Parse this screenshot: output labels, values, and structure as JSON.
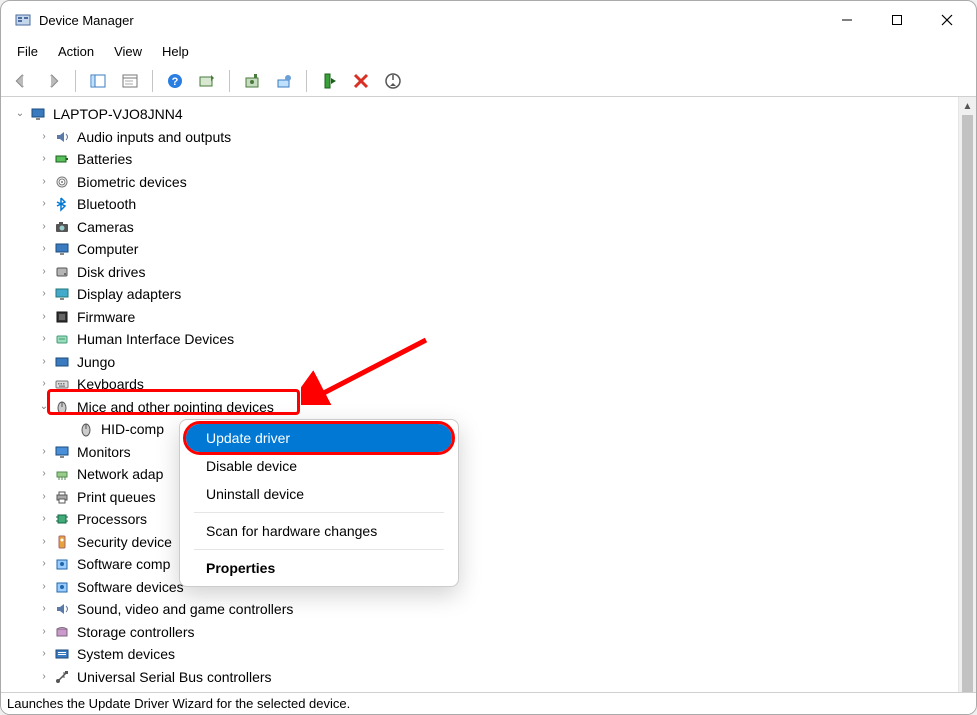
{
  "title": "Device Manager",
  "menus": {
    "file": "File",
    "action": "Action",
    "view": "View",
    "help": "Help"
  },
  "root": "LAPTOP-VJO8JNN4",
  "categories": [
    {
      "label": "Audio inputs and outputs",
      "icon": "audio"
    },
    {
      "label": "Batteries",
      "icon": "battery"
    },
    {
      "label": "Biometric devices",
      "icon": "biometric"
    },
    {
      "label": "Bluetooth",
      "icon": "bluetooth"
    },
    {
      "label": "Cameras",
      "icon": "camera"
    },
    {
      "label": "Computer",
      "icon": "computer"
    },
    {
      "label": "Disk drives",
      "icon": "disk"
    },
    {
      "label": "Display adapters",
      "icon": "display"
    },
    {
      "label": "Firmware",
      "icon": "firmware"
    },
    {
      "label": "Human Interface Devices",
      "icon": "hid"
    },
    {
      "label": "Jungo",
      "icon": "jungo"
    },
    {
      "label": "Keyboards",
      "icon": "keyboard"
    },
    {
      "label": "Mice and other pointing devices",
      "icon": "mouse",
      "expanded": true,
      "children": [
        "HID-comp"
      ]
    },
    {
      "label": "Monitors",
      "icon": "monitor"
    },
    {
      "label": "Network adap",
      "icon": "network"
    },
    {
      "label": "Print queues",
      "icon": "printer"
    },
    {
      "label": "Processors",
      "icon": "cpu"
    },
    {
      "label": "Security device",
      "icon": "security"
    },
    {
      "label": "Software comp",
      "icon": "soft"
    },
    {
      "label": "Software devices",
      "icon": "soft"
    },
    {
      "label": "Sound, video and game controllers",
      "icon": "audio"
    },
    {
      "label": "Storage controllers",
      "icon": "storage"
    },
    {
      "label": "System devices",
      "icon": "system"
    },
    {
      "label": "Universal Serial Bus controllers",
      "icon": "usb"
    }
  ],
  "context_menu": {
    "update": "Update driver",
    "disable": "Disable device",
    "uninstall": "Uninstall device",
    "scan": "Scan for hardware changes",
    "properties": "Properties"
  },
  "status": "Launches the Update Driver Wizard for the selected device."
}
